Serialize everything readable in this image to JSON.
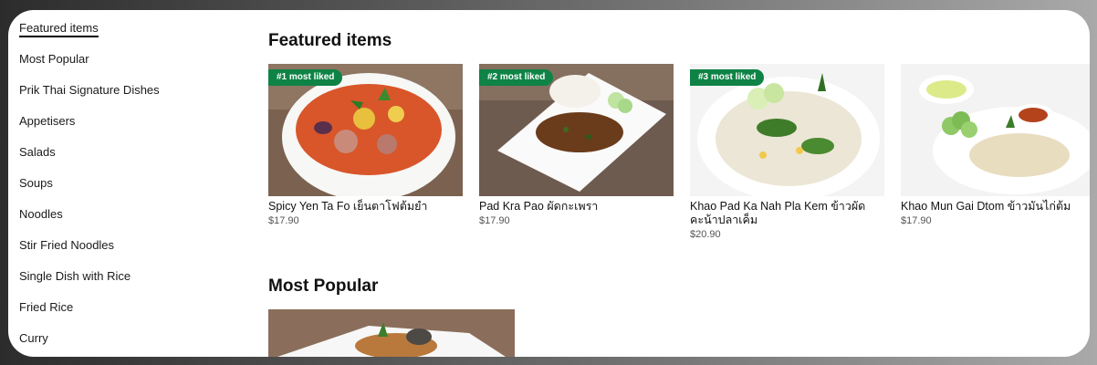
{
  "sidebar": {
    "items": [
      {
        "label": "Featured items"
      },
      {
        "label": "Most Popular"
      },
      {
        "label": "Prik Thai Signature Dishes"
      },
      {
        "label": "Appetisers"
      },
      {
        "label": "Salads"
      },
      {
        "label": "Soups"
      },
      {
        "label": "Noodles"
      },
      {
        "label": "Stir Fried Noodles"
      },
      {
        "label": "Single Dish with Rice"
      },
      {
        "label": "Fried Rice"
      },
      {
        "label": "Curry"
      }
    ]
  },
  "featured": {
    "title": "Featured items",
    "items": [
      {
        "badge": "#1 most liked",
        "name": "Spicy Yen Ta Fo เย็นตาโฟต้มยำ",
        "price": "$17.90"
      },
      {
        "badge": "#2 most liked",
        "name": "Pad Kra Pao ผัดกะเพรา",
        "price": "$17.90"
      },
      {
        "badge": "#3 most liked",
        "name": "Khao Pad Ka Nah Pla Kem ข้าวผัดคะน้าปลาเค็ม",
        "price": "$20.90"
      },
      {
        "badge": "",
        "name": "Khao Mun Gai Dtom ข้าวมันไก่ต้ม",
        "price": "$17.90"
      }
    ]
  },
  "popular": {
    "title": "Most Popular"
  }
}
